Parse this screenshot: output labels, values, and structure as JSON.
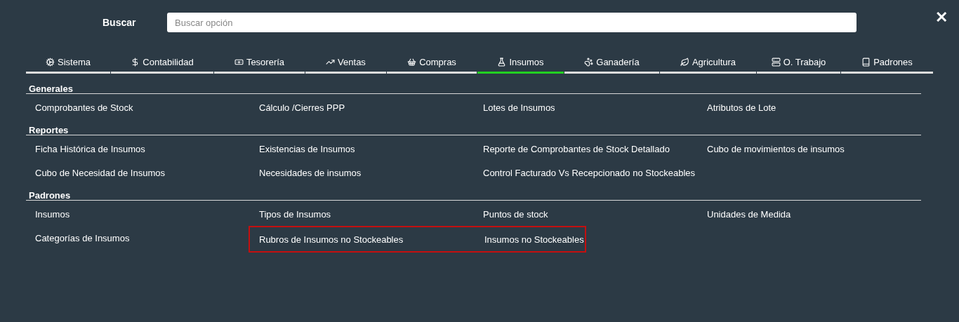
{
  "search": {
    "label": "Buscar",
    "placeholder": "Buscar opción"
  },
  "close": "✕",
  "tabs": [
    {
      "label": "Sistema",
      "selected": false
    },
    {
      "label": "Contabilidad",
      "selected": false
    },
    {
      "label": "Tesorería",
      "selected": false
    },
    {
      "label": "Ventas",
      "selected": false
    },
    {
      "label": "Compras",
      "selected": false
    },
    {
      "label": "Insumos",
      "selected": true
    },
    {
      "label": "Ganadería",
      "selected": false
    },
    {
      "label": "Agricultura",
      "selected": false
    },
    {
      "label": "O. Trabajo",
      "selected": false
    },
    {
      "label": "Padrones",
      "selected": false
    }
  ],
  "sections": [
    {
      "title": "Generales",
      "items": [
        {
          "label": "Comprobantes de Stock",
          "highlighted": false
        },
        {
          "label": "Cálculo /Cierres PPP",
          "highlighted": false
        },
        {
          "label": "Lotes de Insumos",
          "highlighted": false
        },
        {
          "label": "Atributos de Lote",
          "highlighted": false
        }
      ]
    },
    {
      "title": "Reportes",
      "items": [
        {
          "label": "Ficha Histórica de Insumos",
          "highlighted": false
        },
        {
          "label": "Existencias de Insumos",
          "highlighted": false
        },
        {
          "label": "Reporte de Comprobantes de Stock Detallado",
          "highlighted": false
        },
        {
          "label": "Cubo de movimientos de insumos",
          "highlighted": false
        },
        {
          "label": "Cubo de Necesidad de Insumos",
          "highlighted": false
        },
        {
          "label": "Necesidades de insumos",
          "highlighted": false
        },
        {
          "label": "Control Facturado Vs Recepcionado no Stockeables",
          "highlighted": false
        }
      ]
    },
    {
      "title": "Padrones",
      "items": [
        {
          "label": "Insumos",
          "highlighted": false
        },
        {
          "label": "Tipos de Insumos",
          "highlighted": false
        },
        {
          "label": "Puntos de stock",
          "highlighted": false
        },
        {
          "label": "Unidades de Medida",
          "highlighted": false
        },
        {
          "label": "Categorías de Insumos",
          "highlighted": false
        },
        {
          "label": "Rubros de Insumos no Stockeables",
          "highlighted": true
        },
        {
          "label": "Insumos no Stockeables",
          "highlighted": true
        }
      ]
    }
  ]
}
